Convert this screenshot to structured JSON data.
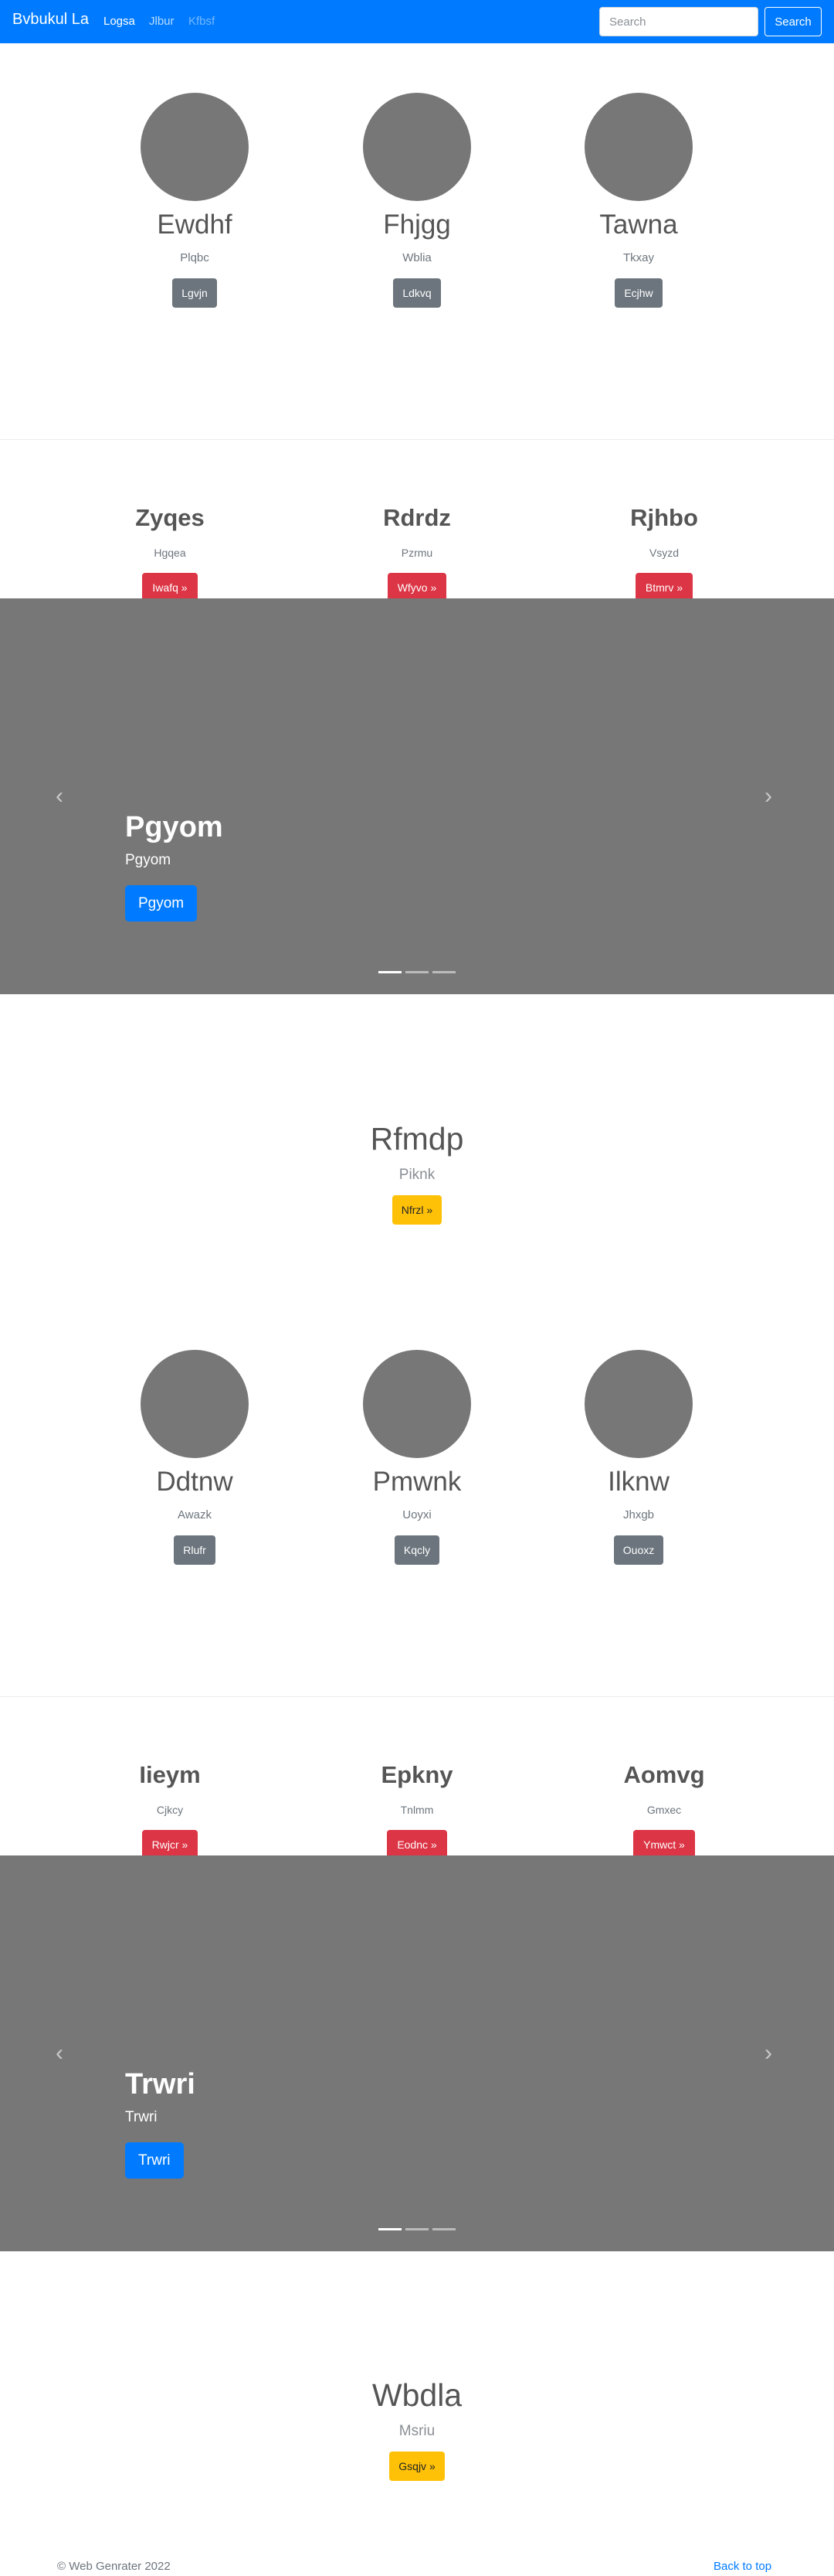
{
  "navbar": {
    "brand": "Bvbukul La",
    "links": [
      "Logsa",
      "Jlbur",
      "Kfbsf"
    ],
    "search_placeholder": "Search",
    "search_button": "Search"
  },
  "team_1": [
    {
      "name": "Ewdhf",
      "sub": "Plqbc",
      "button": "Lgvjn"
    },
    {
      "name": "Fhjgg",
      "sub": "Wblia",
      "button": "Ldkvq"
    },
    {
      "name": "Tawna",
      "sub": "Tkxay",
      "button": "Ecjhw"
    }
  ],
  "features_1": [
    {
      "title": "Zyqes",
      "sub": "Hgqea",
      "button": "Iwafq »"
    },
    {
      "title": "Rdrdz",
      "sub": "Pzrmu",
      "button": "Wfyvo »"
    },
    {
      "title": "Rjhbo",
      "sub": "Vsyzd",
      "button": "Btmrv »"
    }
  ],
  "carousel_1": {
    "title": "Pgyom",
    "text": "Pgyom",
    "button": "Pgyom",
    "prev": "‹",
    "next": "›",
    "slide_count": 3,
    "active_slide": 1
  },
  "cta_1": {
    "title": "Rfmdp",
    "sub": "Piknk",
    "button": "Nfrzl »"
  },
  "team_2": [
    {
      "name": "Ddtnw",
      "sub": "Awazk",
      "button": "Rlufr"
    },
    {
      "name": "Pmwnk",
      "sub": "Uoyxi",
      "button": "Kqcly"
    },
    {
      "name": "Ilknw",
      "sub": "Jhxgb",
      "button": "Ouoxz"
    }
  ],
  "features_2": [
    {
      "title": "Iieym",
      "sub": "Cjkcy",
      "button": "Rwjcr »"
    },
    {
      "title": "Epkny",
      "sub": "Tnlmm",
      "button": "Eodnc »"
    },
    {
      "title": "Aomvg",
      "sub": "Gmxec",
      "button": "Ymwct »"
    }
  ],
  "carousel_2": {
    "title": "Trwri",
    "text": "Trwri",
    "button": "Trwri",
    "prev": "‹",
    "next": "›",
    "slide_count": 3,
    "active_slide": 1
  },
  "cta_2": {
    "title": "Wbdla",
    "sub": "Msriu",
    "button": "Gsqjv »"
  },
  "footer": {
    "copyright": "© Web Genrater 2022",
    "back_to_top": "Back to top"
  },
  "colors": {
    "primary": "#007bff",
    "danger": "#dc3545",
    "warning": "#ffc107",
    "secondary": "#6c757d",
    "placeholder": "#777777"
  }
}
